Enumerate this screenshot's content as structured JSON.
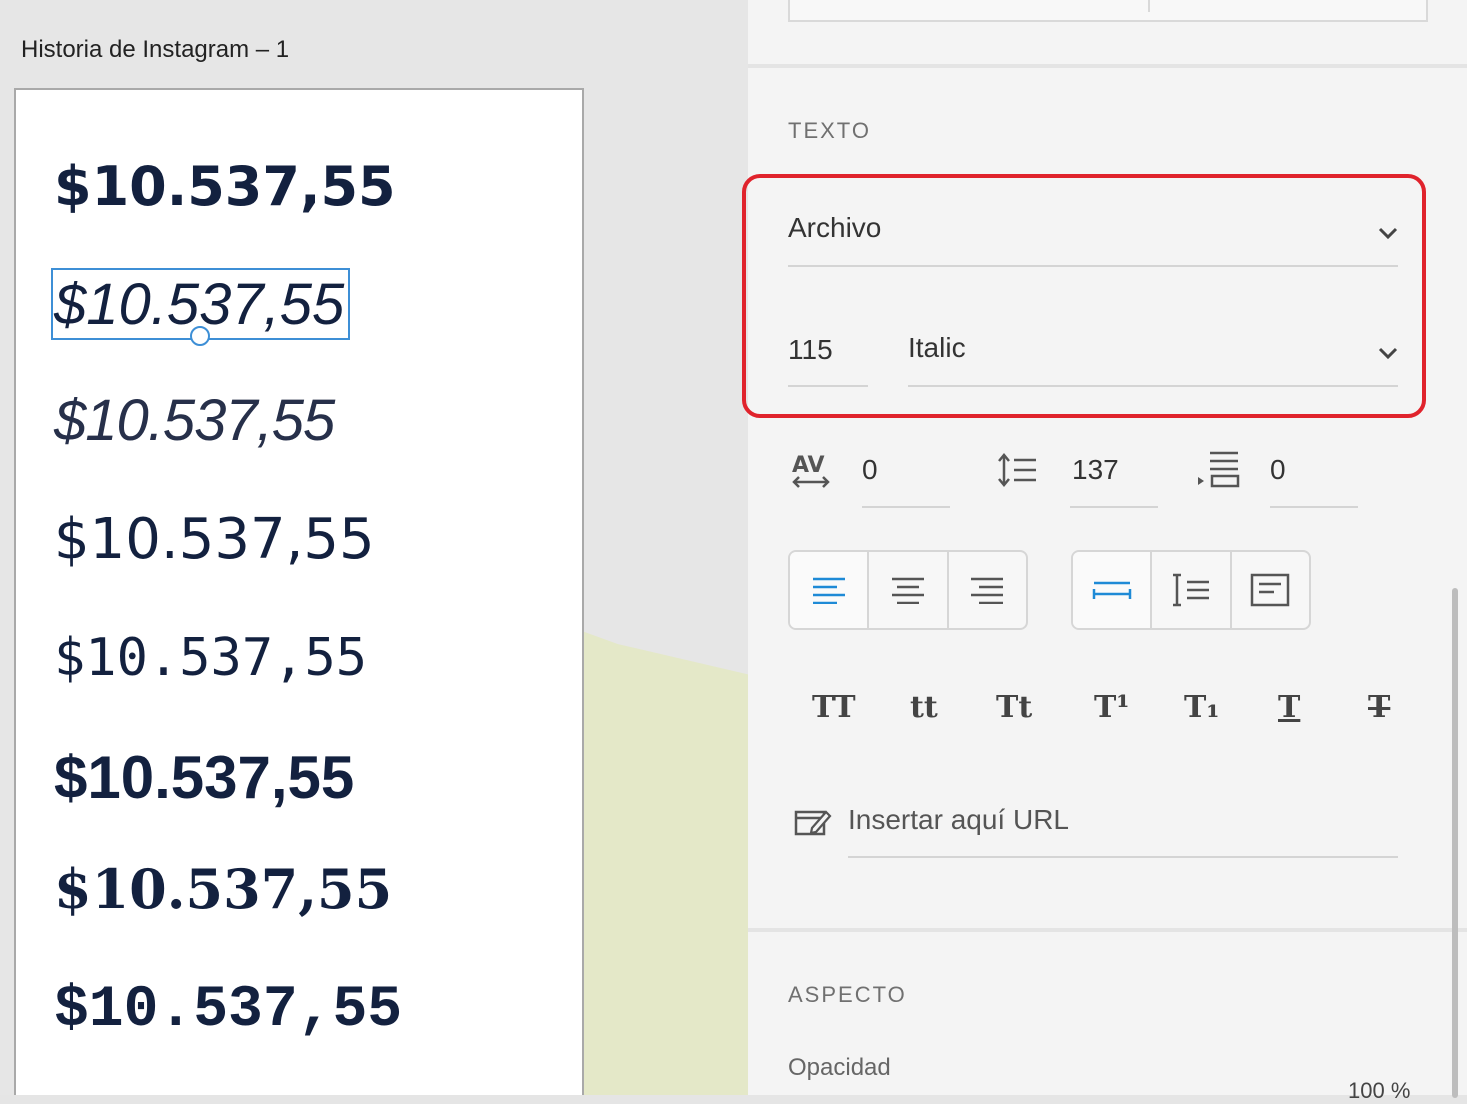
{
  "artboard": {
    "title": "Historia de Instagram – 1",
    "samples": [
      "$10.537,55",
      "$10.537,55",
      "$10.537,55",
      "$10.537,55",
      "$10.537,55",
      "$10.537,55",
      "$10.537,55",
      "$10.537,55"
    ]
  },
  "panel": {
    "text_section": {
      "label": "TEXTO",
      "font_family": "Archivo",
      "font_size": "115",
      "font_style": "Italic",
      "character_spacing": "0",
      "line_spacing": "137",
      "paragraph_spacing": "0",
      "url_placeholder": "Insertar aquí URL",
      "transform_buttons": [
        "TT",
        "tt",
        "Tt",
        "T¹",
        "T₁",
        "T",
        "T"
      ]
    },
    "appearance_section": {
      "label": "ASPECTO",
      "opacity_label": "Opacidad",
      "opacity_value": "100 %"
    }
  },
  "colors": {
    "highlight": "#e0232c",
    "accent": "#1e8ad6",
    "text_sample": "#13213f"
  }
}
